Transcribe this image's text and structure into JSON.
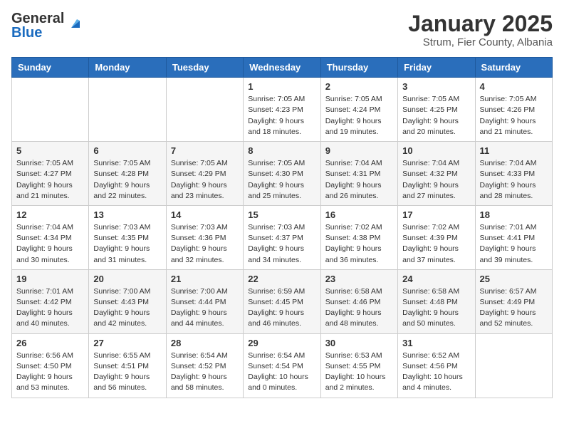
{
  "header": {
    "logo_general": "General",
    "logo_blue": "Blue",
    "title": "January 2025",
    "subtitle": "Strum, Fier County, Albania"
  },
  "days_of_week": [
    "Sunday",
    "Monday",
    "Tuesday",
    "Wednesday",
    "Thursday",
    "Friday",
    "Saturday"
  ],
  "weeks": [
    [
      {
        "day": "",
        "info": ""
      },
      {
        "day": "",
        "info": ""
      },
      {
        "day": "",
        "info": ""
      },
      {
        "day": "1",
        "info": "Sunrise: 7:05 AM\nSunset: 4:23 PM\nDaylight: 9 hours\nand 18 minutes."
      },
      {
        "day": "2",
        "info": "Sunrise: 7:05 AM\nSunset: 4:24 PM\nDaylight: 9 hours\nand 19 minutes."
      },
      {
        "day": "3",
        "info": "Sunrise: 7:05 AM\nSunset: 4:25 PM\nDaylight: 9 hours\nand 20 minutes."
      },
      {
        "day": "4",
        "info": "Sunrise: 7:05 AM\nSunset: 4:26 PM\nDaylight: 9 hours\nand 21 minutes."
      }
    ],
    [
      {
        "day": "5",
        "info": "Sunrise: 7:05 AM\nSunset: 4:27 PM\nDaylight: 9 hours\nand 21 minutes."
      },
      {
        "day": "6",
        "info": "Sunrise: 7:05 AM\nSunset: 4:28 PM\nDaylight: 9 hours\nand 22 minutes."
      },
      {
        "day": "7",
        "info": "Sunrise: 7:05 AM\nSunset: 4:29 PM\nDaylight: 9 hours\nand 23 minutes."
      },
      {
        "day": "8",
        "info": "Sunrise: 7:05 AM\nSunset: 4:30 PM\nDaylight: 9 hours\nand 25 minutes."
      },
      {
        "day": "9",
        "info": "Sunrise: 7:04 AM\nSunset: 4:31 PM\nDaylight: 9 hours\nand 26 minutes."
      },
      {
        "day": "10",
        "info": "Sunrise: 7:04 AM\nSunset: 4:32 PM\nDaylight: 9 hours\nand 27 minutes."
      },
      {
        "day": "11",
        "info": "Sunrise: 7:04 AM\nSunset: 4:33 PM\nDaylight: 9 hours\nand 28 minutes."
      }
    ],
    [
      {
        "day": "12",
        "info": "Sunrise: 7:04 AM\nSunset: 4:34 PM\nDaylight: 9 hours\nand 30 minutes."
      },
      {
        "day": "13",
        "info": "Sunrise: 7:03 AM\nSunset: 4:35 PM\nDaylight: 9 hours\nand 31 minutes."
      },
      {
        "day": "14",
        "info": "Sunrise: 7:03 AM\nSunset: 4:36 PM\nDaylight: 9 hours\nand 32 minutes."
      },
      {
        "day": "15",
        "info": "Sunrise: 7:03 AM\nSunset: 4:37 PM\nDaylight: 9 hours\nand 34 minutes."
      },
      {
        "day": "16",
        "info": "Sunrise: 7:02 AM\nSunset: 4:38 PM\nDaylight: 9 hours\nand 36 minutes."
      },
      {
        "day": "17",
        "info": "Sunrise: 7:02 AM\nSunset: 4:39 PM\nDaylight: 9 hours\nand 37 minutes."
      },
      {
        "day": "18",
        "info": "Sunrise: 7:01 AM\nSunset: 4:41 PM\nDaylight: 9 hours\nand 39 minutes."
      }
    ],
    [
      {
        "day": "19",
        "info": "Sunrise: 7:01 AM\nSunset: 4:42 PM\nDaylight: 9 hours\nand 40 minutes."
      },
      {
        "day": "20",
        "info": "Sunrise: 7:00 AM\nSunset: 4:43 PM\nDaylight: 9 hours\nand 42 minutes."
      },
      {
        "day": "21",
        "info": "Sunrise: 7:00 AM\nSunset: 4:44 PM\nDaylight: 9 hours\nand 44 minutes."
      },
      {
        "day": "22",
        "info": "Sunrise: 6:59 AM\nSunset: 4:45 PM\nDaylight: 9 hours\nand 46 minutes."
      },
      {
        "day": "23",
        "info": "Sunrise: 6:58 AM\nSunset: 4:46 PM\nDaylight: 9 hours\nand 48 minutes."
      },
      {
        "day": "24",
        "info": "Sunrise: 6:58 AM\nSunset: 4:48 PM\nDaylight: 9 hours\nand 50 minutes."
      },
      {
        "day": "25",
        "info": "Sunrise: 6:57 AM\nSunset: 4:49 PM\nDaylight: 9 hours\nand 52 minutes."
      }
    ],
    [
      {
        "day": "26",
        "info": "Sunrise: 6:56 AM\nSunset: 4:50 PM\nDaylight: 9 hours\nand 53 minutes."
      },
      {
        "day": "27",
        "info": "Sunrise: 6:55 AM\nSunset: 4:51 PM\nDaylight: 9 hours\nand 56 minutes."
      },
      {
        "day": "28",
        "info": "Sunrise: 6:54 AM\nSunset: 4:52 PM\nDaylight: 9 hours\nand 58 minutes."
      },
      {
        "day": "29",
        "info": "Sunrise: 6:54 AM\nSunset: 4:54 PM\nDaylight: 10 hours\nand 0 minutes."
      },
      {
        "day": "30",
        "info": "Sunrise: 6:53 AM\nSunset: 4:55 PM\nDaylight: 10 hours\nand 2 minutes."
      },
      {
        "day": "31",
        "info": "Sunrise: 6:52 AM\nSunset: 4:56 PM\nDaylight: 10 hours\nand 4 minutes."
      },
      {
        "day": "",
        "info": ""
      }
    ]
  ]
}
